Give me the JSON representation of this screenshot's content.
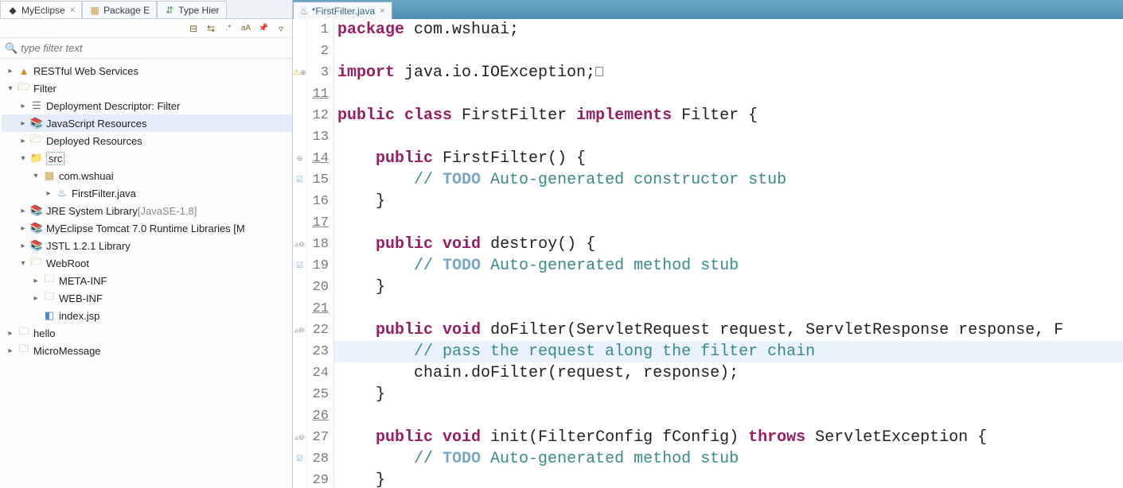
{
  "views": {
    "tabs": [
      {
        "label": "MyEclipse",
        "icon": "myeclipse-icon",
        "closable": true
      },
      {
        "label": "Package E",
        "icon": "package-explorer-icon",
        "closable": false
      },
      {
        "label": "Type Hier",
        "icon": "type-hierarchy-icon",
        "closable": false
      }
    ],
    "active_index": 0
  },
  "toolbar": {
    "buttons": [
      {
        "name": "collapse-all-button",
        "glyph": "⊟"
      },
      {
        "name": "link-with-editor-button",
        "glyph": "⇆"
      },
      {
        "name": "filter-regex-button",
        "glyph": ".*"
      },
      {
        "name": "match-case-button",
        "glyph": "aA"
      },
      {
        "name": "pin-button",
        "glyph": "📌"
      },
      {
        "name": "view-menu-button",
        "glyph": "▿"
      }
    ]
  },
  "filter": {
    "placeholder": "type filter text"
  },
  "tree": [
    {
      "depth": 0,
      "exp": ">",
      "icon": "restful-icon",
      "iconColor": "#d98a2a",
      "label": "RESTful Web Services"
    },
    {
      "depth": 0,
      "exp": "v",
      "icon": "project-icon",
      "iconColor": "#c9a24a",
      "label": "Filter"
    },
    {
      "depth": 1,
      "exp": ">",
      "icon": "deployment-descriptor-icon",
      "iconColor": "#6a7a8a",
      "label": "Deployment Descriptor: Filter"
    },
    {
      "depth": 1,
      "exp": ">",
      "icon": "js-resources-icon",
      "iconColor": "#c9a24a",
      "label": "JavaScript Resources",
      "selected": true
    },
    {
      "depth": 1,
      "exp": ">",
      "icon": "deployed-resources-icon",
      "iconColor": "#c9a24a",
      "label": "Deployed Resources"
    },
    {
      "depth": 1,
      "exp": "v",
      "icon": "src-folder-icon",
      "iconColor": "#c9a24a",
      "label": "src",
      "boxed": true
    },
    {
      "depth": 2,
      "exp": "v",
      "icon": "package-icon",
      "iconColor": "#c9a24a",
      "label": "com.wshuai"
    },
    {
      "depth": 3,
      "exp": ">",
      "icon": "java-file-icon",
      "iconColor": "#5a7aa8",
      "label": "FirstFilter.java"
    },
    {
      "depth": 1,
      "exp": ">",
      "icon": "library-icon",
      "iconColor": "#c9a24a",
      "label": "JRE System Library ",
      "qualifier": "[JavaSE-1.8]"
    },
    {
      "depth": 1,
      "exp": ">",
      "icon": "library-icon",
      "iconColor": "#c9a24a",
      "label": "MyEclipse Tomcat 7.0 Runtime Libraries [M"
    },
    {
      "depth": 1,
      "exp": ">",
      "icon": "library-icon",
      "iconColor": "#c9a24a",
      "label": "JSTL 1.2.1 Library"
    },
    {
      "depth": 1,
      "exp": "v",
      "icon": "webroot-folder-icon",
      "iconColor": "#c9a24a",
      "label": "WebRoot"
    },
    {
      "depth": 2,
      "exp": ">",
      "icon": "folder-icon",
      "iconColor": "#c9a24a",
      "label": "META-INF"
    },
    {
      "depth": 2,
      "exp": ">",
      "icon": "folder-icon",
      "iconColor": "#c9a24a",
      "label": "WEB-INF"
    },
    {
      "depth": 2,
      "exp": "",
      "icon": "jsp-file-icon",
      "iconColor": "#4a8ad6",
      "label": "index.jsp"
    },
    {
      "depth": 0,
      "exp": ">",
      "icon": "project-closed-icon",
      "iconColor": "#7aa0c4",
      "label": "hello"
    },
    {
      "depth": 0,
      "exp": ">",
      "icon": "project-closed-icon",
      "iconColor": "#7aa0c4",
      "label": "MicroMessage"
    }
  ],
  "editor": {
    "tab": {
      "label": "*FirstFilter.java",
      "icon": "java-file-icon"
    },
    "lines": [
      {
        "n": 1,
        "u": false,
        "marker": "",
        "tokens": [
          [
            "kw",
            "package"
          ],
          [
            "txt",
            " com.wshuai;"
          ]
        ]
      },
      {
        "n": 2,
        "u": false,
        "marker": "",
        "tokens": []
      },
      {
        "n": 3,
        "u": false,
        "marker": "warn-fold",
        "tokens": [
          [
            "kw",
            "import"
          ],
          [
            "txt",
            " java.io.IOException;"
          ],
          [
            "box",
            ""
          ]
        ]
      },
      {
        "n": 11,
        "u": true,
        "marker": "",
        "tokens": []
      },
      {
        "n": 12,
        "u": false,
        "marker": "",
        "tokens": [
          [
            "kw",
            "public"
          ],
          [
            "txt",
            " "
          ],
          [
            "kw",
            "class"
          ],
          [
            "txt",
            " FirstFilter "
          ],
          [
            "kw",
            "implements"
          ],
          [
            "txt",
            " Filter {"
          ]
        ]
      },
      {
        "n": 13,
        "u": false,
        "marker": "",
        "tokens": []
      },
      {
        "n": 14,
        "u": true,
        "marker": "fold",
        "tokens": [
          [
            "txt",
            "    "
          ],
          [
            "kw",
            "public"
          ],
          [
            "txt",
            " FirstFilter() {"
          ]
        ]
      },
      {
        "n": 15,
        "u": false,
        "marker": "todo",
        "tokens": [
          [
            "txt",
            "        "
          ],
          [
            "comment",
            "// "
          ],
          [
            "todo",
            "TODO"
          ],
          [
            "comment",
            " Auto-generated constructor stub"
          ]
        ]
      },
      {
        "n": 16,
        "u": false,
        "marker": "",
        "tokens": [
          [
            "txt",
            "    }"
          ]
        ]
      },
      {
        "n": 17,
        "u": true,
        "marker": "",
        "tokens": []
      },
      {
        "n": 18,
        "u": false,
        "marker": "override-fold",
        "tokens": [
          [
            "txt",
            "    "
          ],
          [
            "kw",
            "public"
          ],
          [
            "txt",
            " "
          ],
          [
            "kw",
            "void"
          ],
          [
            "txt",
            " destroy() {"
          ]
        ]
      },
      {
        "n": 19,
        "u": false,
        "marker": "todo",
        "tokens": [
          [
            "txt",
            "        "
          ],
          [
            "comment",
            "// "
          ],
          [
            "todo",
            "TODO"
          ],
          [
            "comment",
            " Auto-generated method stub"
          ]
        ]
      },
      {
        "n": 20,
        "u": false,
        "marker": "",
        "tokens": [
          [
            "txt",
            "    }"
          ]
        ]
      },
      {
        "n": 21,
        "u": true,
        "marker": "",
        "tokens": []
      },
      {
        "n": 22,
        "u": false,
        "marker": "override-fold",
        "tokens": [
          [
            "txt",
            "    "
          ],
          [
            "kw",
            "public"
          ],
          [
            "txt",
            " "
          ],
          [
            "kw",
            "void"
          ],
          [
            "txt",
            " doFilter(ServletRequest request, ServletResponse response, F"
          ]
        ]
      },
      {
        "n": 23,
        "u": false,
        "marker": "",
        "hl": true,
        "tokens": [
          [
            "txt",
            "        "
          ],
          [
            "comment",
            "// pass the request along the filter chain"
          ]
        ]
      },
      {
        "n": 24,
        "u": false,
        "marker": "",
        "tokens": [
          [
            "txt",
            "        chain.doFilter(request, response);"
          ]
        ]
      },
      {
        "n": 25,
        "u": false,
        "marker": "",
        "tokens": [
          [
            "txt",
            "    }"
          ]
        ]
      },
      {
        "n": 26,
        "u": true,
        "marker": "",
        "tokens": []
      },
      {
        "n": 27,
        "u": false,
        "marker": "override-fold",
        "tokens": [
          [
            "txt",
            "    "
          ],
          [
            "kw",
            "public"
          ],
          [
            "txt",
            " "
          ],
          [
            "kw",
            "void"
          ],
          [
            "txt",
            " init(FilterConfig fConfig) "
          ],
          [
            "kw",
            "throws"
          ],
          [
            "txt",
            " ServletException {"
          ]
        ]
      },
      {
        "n": 28,
        "u": false,
        "marker": "todo",
        "tokens": [
          [
            "txt",
            "        "
          ],
          [
            "comment",
            "// "
          ],
          [
            "todo",
            "TODO"
          ],
          [
            "comment",
            " Auto-generated method stub"
          ]
        ]
      },
      {
        "n": 29,
        "u": false,
        "marker": "",
        "tokens": [
          [
            "txt",
            "    }"
          ]
        ]
      }
    ]
  }
}
